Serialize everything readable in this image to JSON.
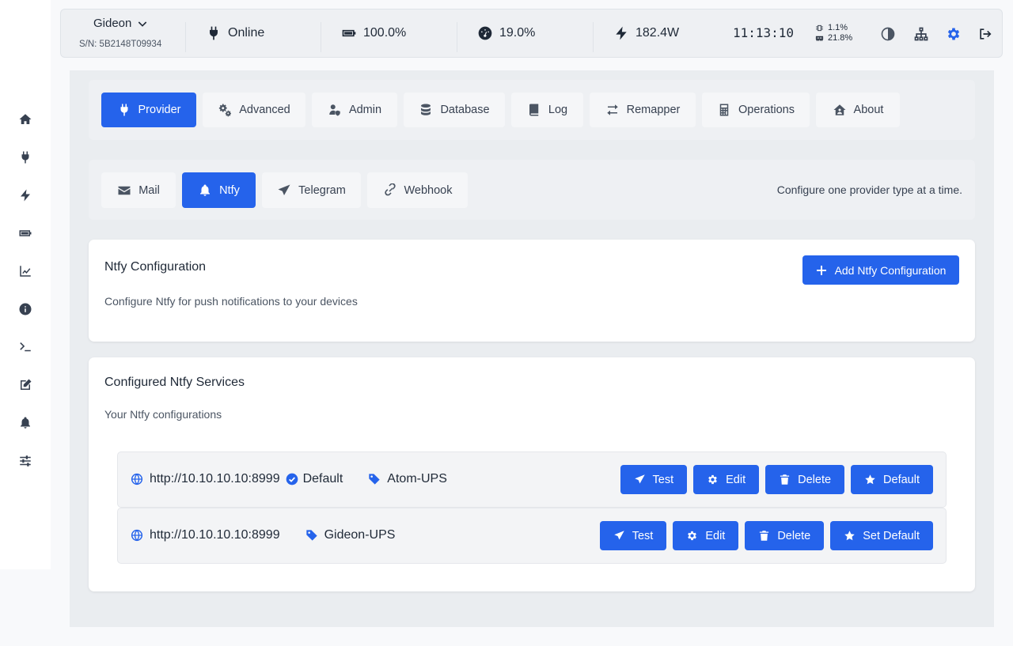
{
  "header": {
    "device_name": "Gideon",
    "serial": "S/N: 5B2148T09934",
    "status": "Online",
    "battery": "100.0%",
    "load": "19.0%",
    "power": "182.4W",
    "clock": "11:13:10",
    "cpu": "1.1%",
    "memory": "21.8%"
  },
  "tabs": [
    {
      "label": "Provider",
      "icon": "plug-icon",
      "active": true
    },
    {
      "label": "Advanced",
      "icon": "gears-icon"
    },
    {
      "label": "Admin",
      "icon": "user-shield-icon"
    },
    {
      "label": "Database",
      "icon": "database-icon"
    },
    {
      "label": "Log",
      "icon": "book-icon"
    },
    {
      "label": "Remapper",
      "icon": "arrows-swap-icon"
    },
    {
      "label": "Operations",
      "icon": "calculator-icon"
    },
    {
      "label": "About",
      "icon": "house-user-icon"
    }
  ],
  "subtabs": [
    {
      "label": "Mail",
      "icon": "envelope-icon"
    },
    {
      "label": "Ntfy",
      "icon": "bell-icon",
      "active": true
    },
    {
      "label": "Telegram",
      "icon": "paper-plane-icon"
    },
    {
      "label": "Webhook",
      "icon": "link-icon"
    }
  ],
  "subtab_hint": "Configure one provider type at a time.",
  "config_card": {
    "title": "Ntfy Configuration",
    "description": "Configure Ntfy for push notifications to your devices",
    "add_button": "Add Ntfy Configuration"
  },
  "services_card": {
    "title": "Configured Ntfy Services",
    "description": "Your Ntfy configurations",
    "services": [
      {
        "url": "http://10.10.10.10:8999",
        "default_label": "Default",
        "tag": "Atom-UPS",
        "buttons": {
          "test": "Test",
          "edit": "Edit",
          "delete": "Delete",
          "default": "Default"
        }
      },
      {
        "url": "http://10.10.10.10:8999",
        "tag": "Gideon-UPS",
        "buttons": {
          "test": "Test",
          "edit": "Edit",
          "delete": "Delete",
          "default": "Set Default"
        }
      }
    ]
  },
  "colors": {
    "accent": "#2563eb",
    "background": "#eaedf0"
  }
}
